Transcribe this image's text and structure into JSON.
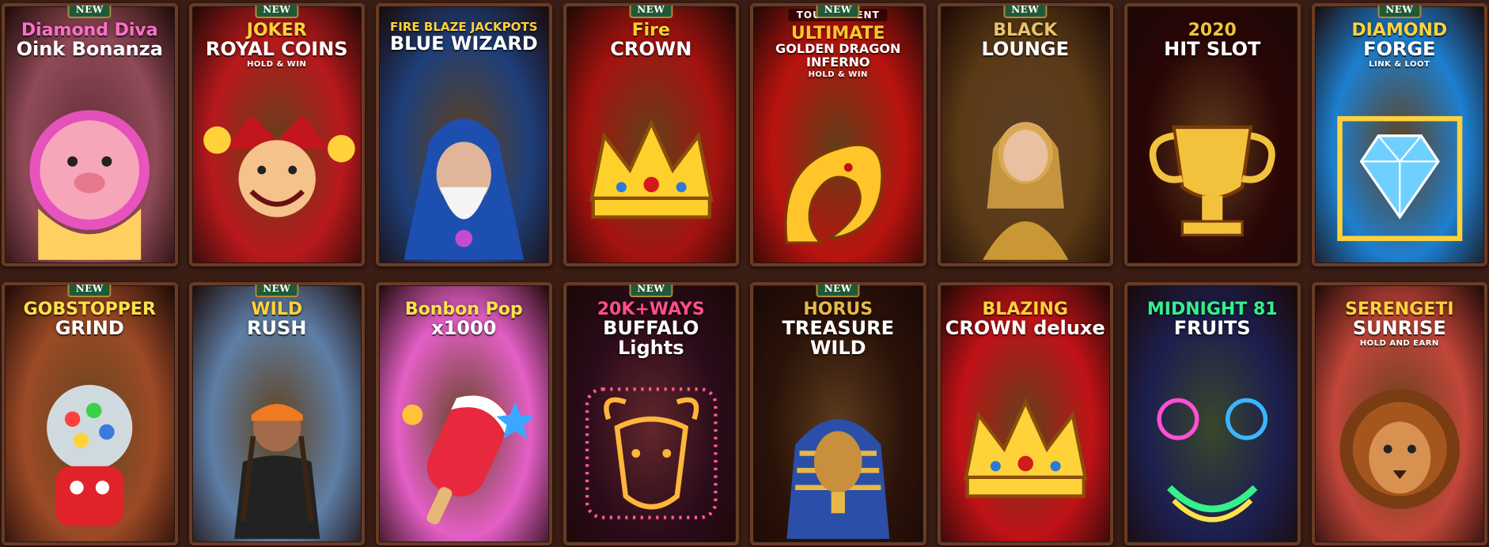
{
  "badge_label": "NEW",
  "tourney_label": "TOURNAMENT",
  "games": [
    {
      "title": "Diamond Diva",
      "subtitle": "Oink Bonanza",
      "tag": "",
      "new": true,
      "bg": "#8f4a57",
      "accent": "#ff6fc8",
      "icon": "pig-icon"
    },
    {
      "title": "JOKER",
      "subtitle": "ROYAL COINS",
      "tag": "HOLD & WIN",
      "new": true,
      "bg": "#b8191c",
      "accent": "#ffd23a",
      "icon": "jester-icon"
    },
    {
      "title": "FIRE BLAZE JACKPOTS",
      "subtitle": "BLUE WIZARD",
      "tag": "",
      "new": false,
      "bg": "#1e3f7a",
      "accent": "#ffd23a",
      "icon": "wizard-icon"
    },
    {
      "title": "Fire",
      "subtitle": "CROWN",
      "tag": "",
      "new": true,
      "bg": "#a5130f",
      "accent": "#ffcf2b",
      "icon": "crown-icon"
    },
    {
      "title": "ULTIMATE",
      "subtitle": "GOLDEN DRAGON INFERNO",
      "tag": "HOLD & WIN",
      "new": true,
      "bg": "#b9130f",
      "accent": "#ffc52b",
      "icon": "dragon-icon"
    },
    {
      "title": "BLACK",
      "subtitle": "LOUNGE",
      "tag": "",
      "new": true,
      "bg": "#5a3a16",
      "accent": "#e6c36a",
      "icon": "woman-icon"
    },
    {
      "title": "2020",
      "subtitle": "HIT SLOT",
      "tag": "",
      "new": false,
      "bg": "#2a0606",
      "accent": "#f3c23c",
      "icon": "trophy-icon"
    },
    {
      "title": "DIAMOND",
      "subtitle": "FORGE",
      "tag": "LINK & LOOT",
      "new": true,
      "bg": "#1d7fd0",
      "accent": "#ffd23a",
      "icon": "diamond-icon"
    },
    {
      "title": "GOBSTOPPER",
      "subtitle": "GRIND",
      "tag": "",
      "new": true,
      "bg": "#9c4a26",
      "accent": "#ffe14a",
      "icon": "gumball-machine-icon"
    },
    {
      "title": "WILD",
      "subtitle": "RUSH",
      "tag": "",
      "new": true,
      "bg": "#5e7ea6",
      "accent": "#ffd23a",
      "icon": "racer-icon"
    },
    {
      "title": "Bonbon Pop",
      "subtitle": "x1000",
      "tag": "",
      "new": false,
      "bg": "#e45fc6",
      "accent": "#ffe14a",
      "icon": "popsicle-icon"
    },
    {
      "title": "20K+WAYS",
      "subtitle": "BUFFALO Lights",
      "tag": "",
      "new": true,
      "bg": "#2a0b1a",
      "accent": "#ff4f86",
      "icon": "buffalo-icon"
    },
    {
      "title": "HORUS",
      "subtitle": "TREASURE WILD",
      "tag": "",
      "new": true,
      "bg": "#2b1309",
      "accent": "#e7b846",
      "icon": "pharaoh-icon"
    },
    {
      "title": "BLAZING",
      "subtitle": "CROWN deluxe",
      "tag": "",
      "new": false,
      "bg": "#c01217",
      "accent": "#ffd23a",
      "icon": "crown-icon"
    },
    {
      "title": "MIDNIGHT 81",
      "subtitle": "FRUITS",
      "tag": "",
      "new": false,
      "bg": "#1c1f4e",
      "accent": "#35f08b",
      "icon": "neon-fruit-icon"
    },
    {
      "title": "SERENGETI",
      "subtitle": "SUNRISE",
      "tag": "HOLD AND EARN",
      "new": false,
      "bg": "#c2463a",
      "accent": "#ffd23a",
      "icon": "lion-icon"
    }
  ],
  "tournament_index": 4
}
